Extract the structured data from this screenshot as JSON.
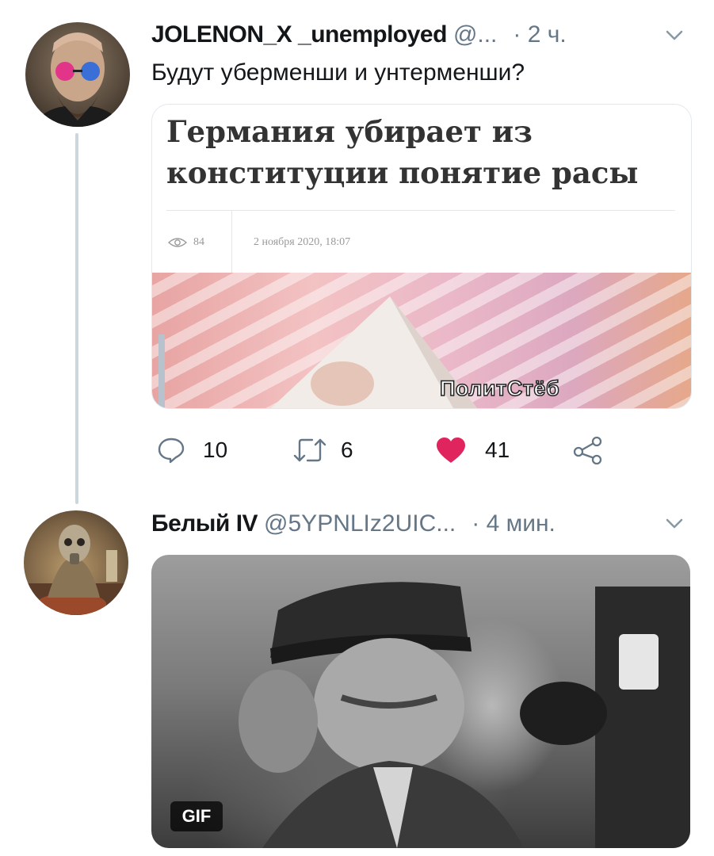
{
  "tweet1": {
    "author_name": "JOLENON_X _unemployed",
    "author_handle": "@...",
    "time": "· 2 ч.",
    "text": "Будут уберменши и унтерменши?",
    "card": {
      "headline": "Германия убирает из конституции понятие расы",
      "views": "84",
      "date": "2 ноября 2020, 18:07"
    },
    "watermark": "ПолитСтёб",
    "actions": {
      "reply_count": "10",
      "retweet_count": "6",
      "like_count": "41"
    }
  },
  "tweet2": {
    "author_name": "Белый IV",
    "author_handle": "@5YPNLIz2UIC...",
    "time": "· 4 мин.",
    "media_badge": "GIF"
  },
  "colors": {
    "like": "#e0245e",
    "secondary_text": "#657786",
    "thread_line": "#ccd6dd"
  },
  "icons": [
    "chevron-down-icon",
    "reply-icon",
    "retweet-icon",
    "heart-icon",
    "share-icon",
    "eye-icon"
  ]
}
